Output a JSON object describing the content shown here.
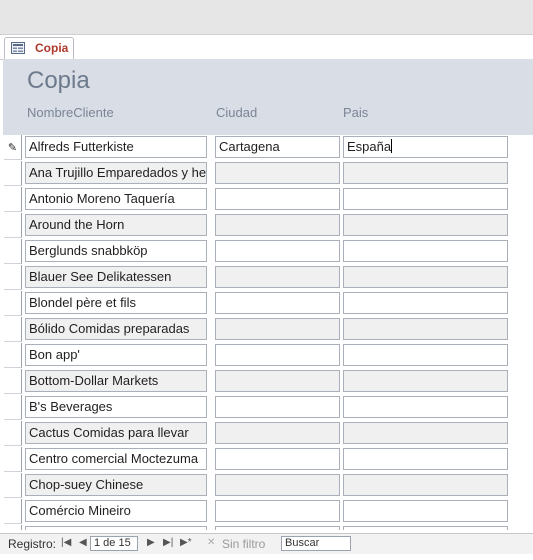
{
  "tab": {
    "label": "Copia"
  },
  "form": {
    "title": "Copia"
  },
  "columns": {
    "name": "NombreCliente",
    "city": "Ciudad",
    "country": "Pais"
  },
  "rows": [
    {
      "name": "Alfreds Futterkiste",
      "city": "Cartagena",
      "country": "España"
    },
    {
      "name": "Ana Trujillo Emparedados y helados",
      "city": "",
      "country": ""
    },
    {
      "name": "Antonio Moreno Taquería",
      "city": "",
      "country": ""
    },
    {
      "name": "Around the Horn",
      "city": "",
      "country": ""
    },
    {
      "name": "Berglunds snabbköp",
      "city": "",
      "country": ""
    },
    {
      "name": "Blauer See Delikatessen",
      "city": "",
      "country": ""
    },
    {
      "name": "Blondel père et fils",
      "city": "",
      "country": ""
    },
    {
      "name": "Bólido Comidas preparadas",
      "city": "",
      "country": ""
    },
    {
      "name": "Bon app'",
      "city": "",
      "country": ""
    },
    {
      "name": "Bottom-Dollar Markets",
      "city": "",
      "country": ""
    },
    {
      "name": "B's Beverages",
      "city": "",
      "country": ""
    },
    {
      "name": "Cactus Comidas para llevar",
      "city": "",
      "country": ""
    },
    {
      "name": "Centro comercial Moctezuma",
      "city": "",
      "country": ""
    },
    {
      "name": "Chop-suey Chinese",
      "city": "",
      "country": ""
    },
    {
      "name": "Comércio Mineiro",
      "city": "",
      "country": ""
    }
  ],
  "navigation": {
    "record_label": "Registro:",
    "record_position": "1 de 15",
    "filter_label": "Sin filtro",
    "search_placeholder": "Buscar",
    "first_glyph": "|◀",
    "prev_glyph": "◀",
    "next_glyph": "▶",
    "last_glyph": "▶|",
    "new_glyph": "▶*",
    "filter_glyph": "✕"
  },
  "icons": {
    "editing_row": "pencil-icon",
    "new_row": "asterisk-icon"
  },
  "colors": {
    "tab_text": "#b0392d",
    "header_bg": "#d8dde6",
    "title_text": "#6d7a8c"
  }
}
